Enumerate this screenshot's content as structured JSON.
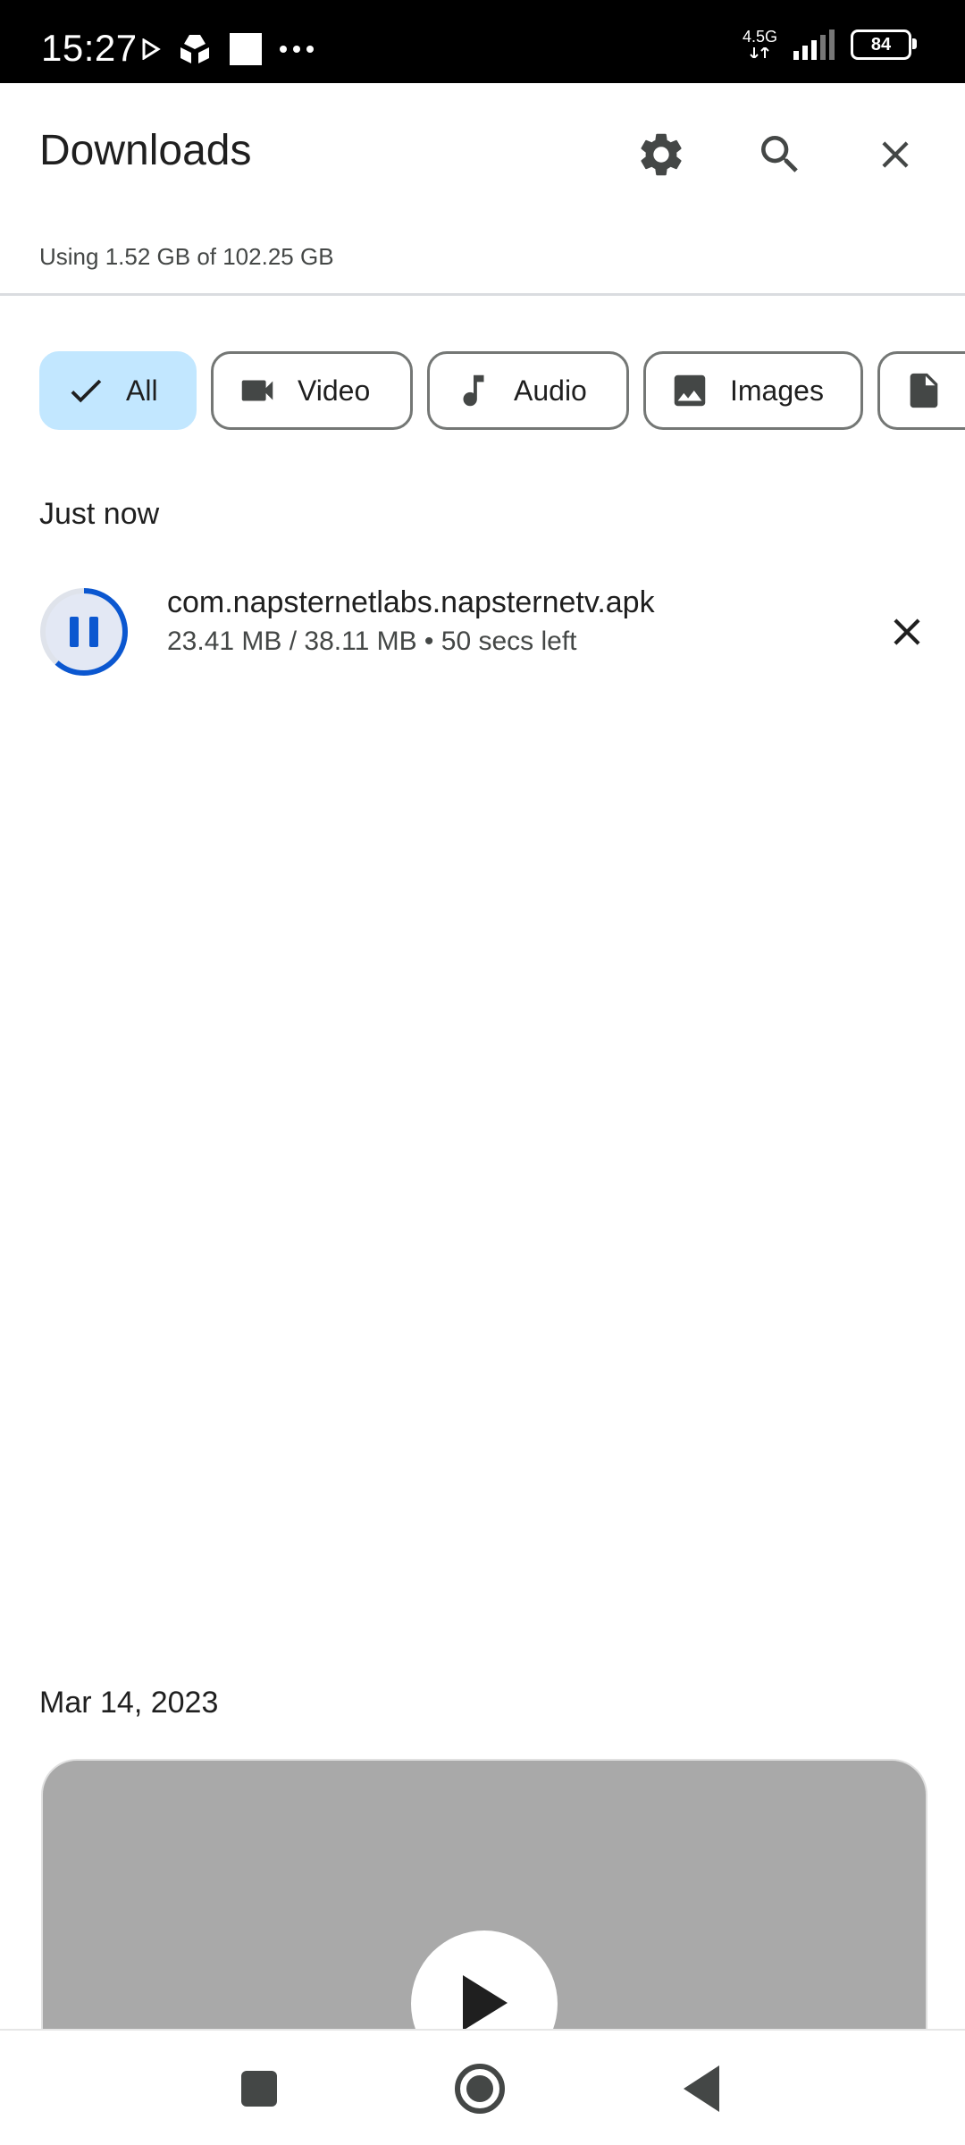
{
  "status_bar": {
    "time": "15:27",
    "network": "4.5G",
    "battery": "84"
  },
  "toolbar": {
    "title": "Downloads",
    "icons": [
      "gear-icon",
      "search-icon",
      "close-icon"
    ]
  },
  "storage": {
    "text": "Using 1.52 GB of 102.25 GB"
  },
  "filters": [
    {
      "label": "All",
      "icon": "check-icon",
      "selected": true
    },
    {
      "label": "Video",
      "icon": "video-camera-icon",
      "selected": false
    },
    {
      "label": "Audio",
      "icon": "music-note-icon",
      "selected": false
    },
    {
      "label": "Images",
      "icon": "image-icon",
      "selected": false
    },
    {
      "label": "",
      "icon": "document-icon",
      "selected": false
    }
  ],
  "sections": [
    {
      "header": "Just now",
      "items": [
        {
          "name": "com.napsternetlabs.napsternetv.apk",
          "meta": "23.41 MB / 38.11 MB • 50 secs left",
          "progress": 0.614,
          "state": "paused-icon"
        }
      ]
    },
    {
      "header": "Mar 14, 2023",
      "items": [
        {
          "type": "video-thumbnail",
          "icon": "play-icon"
        }
      ]
    }
  ],
  "colors": {
    "accent": "#0b57d0",
    "chip_selected_bg": "#c2e7ff",
    "thumbnail_bg": "#a9a9a9"
  }
}
